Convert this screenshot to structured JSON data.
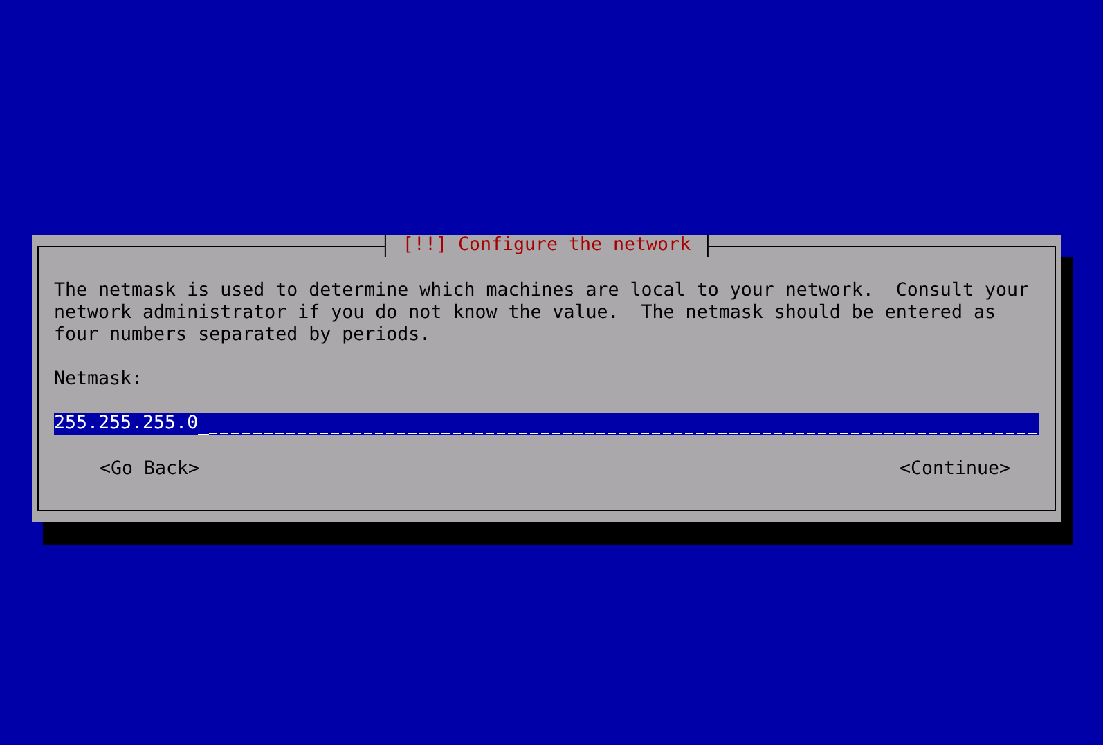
{
  "dialog": {
    "title": "[!!] Configure the network",
    "description": "The netmask is used to determine which machines are local to your network.  Consult your network administrator if you do not know the value.  The netmask should be entered as four numbers separated by periods.",
    "field": {
      "label": "Netmask:",
      "value": "255.255.255.0"
    },
    "buttons": [
      "<Go Back>",
      "<Continue>"
    ]
  }
}
